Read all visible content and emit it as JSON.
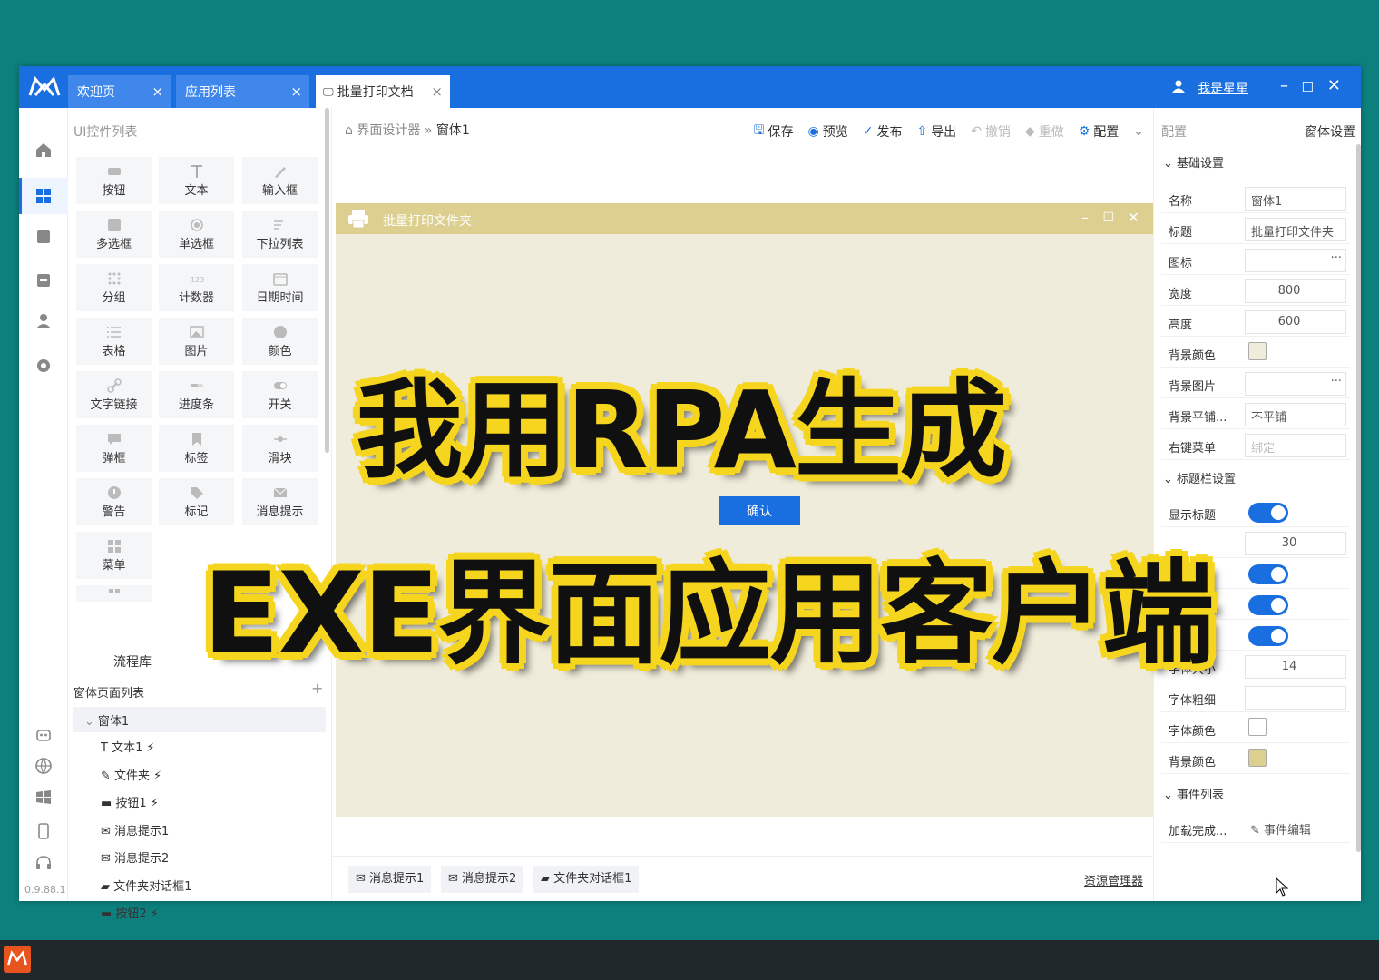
{
  "tabs": [
    {
      "label": "欢迎页",
      "close": "×"
    },
    {
      "label": "应用列表",
      "close": "×"
    },
    {
      "label": "批量打印文档",
      "close": "×"
    }
  ],
  "user": {
    "name": "我是星星"
  },
  "window_buttons": {
    "min": "–",
    "max": "☐",
    "close": "✕"
  },
  "version": "0.9.88.1",
  "palette": {
    "title": "UI控件列表",
    "controls": [
      "按钮",
      "文本",
      "输入框",
      "多选框",
      "单选框",
      "下拉列表",
      "分组",
      "计数器",
      "日期时间",
      "表格",
      "图片",
      "颜色",
      "文字链接",
      "进度条",
      "开关",
      "弹框",
      "标签",
      "滑块",
      "警告",
      "标记",
      "消息提示",
      "菜单"
    ],
    "flow_tab": "流程库",
    "window_list_title": "窗体页面列表",
    "tree_root": "窗体1",
    "tree_items": [
      {
        "label": "文本1",
        "bolt": "⚡"
      },
      {
        "label": "文件夹",
        "bolt": "⚡"
      },
      {
        "label": "按钮1",
        "bolt": "⚡"
      },
      {
        "label": "消息提示1",
        "bolt": ""
      },
      {
        "label": "消息提示2",
        "bolt": ""
      },
      {
        "label": "文件夹对话框1",
        "bolt": ""
      },
      {
        "label": "按钮2",
        "bolt": "⚡"
      }
    ]
  },
  "breadcrumb": {
    "root": "界面设计器",
    "sep": "»",
    "current": "窗体1"
  },
  "toolbar": {
    "save": "保存",
    "preview": "预览",
    "publish": "发布",
    "export": "导出",
    "undo": "撤销",
    "redo": "重做",
    "config": "配置"
  },
  "canvas": {
    "title": "批量打印文件夹",
    "confirm": "确认"
  },
  "bottom_chips": [
    "消息提示1",
    "消息提示2",
    "文件夹对话框1"
  ],
  "resource_link": "资源管理器",
  "right_panel": {
    "head": "配置",
    "head_right": "窗体设置",
    "sec_basic": "基础设置",
    "name_label": "名称",
    "name_value": "窗体1",
    "title_label": "标题",
    "title_value": "批量打印文件夹",
    "icon_label": "图标",
    "dots": "···",
    "width_label": "宽度",
    "width_value": "800",
    "height_label": "高度",
    "height_value": "600",
    "bg_color_label": "背景颜色",
    "bg_image_label": "背景图片",
    "bg_tile_label": "背景平铺...",
    "bg_tile_value": "不平铺",
    "ctx_menu_label": "右键菜单",
    "ctx_menu_value": "绑定",
    "sec_titlebar": "标题栏设置",
    "show_title_label": "显示标题",
    "title_height_value": "30",
    "font_size_label": "字体大小",
    "font_size_value": "14",
    "font_weight_label": "字体粗细",
    "font_color_label": "字体颜色",
    "tb_bg_color_label": "背景颜色",
    "sec_events": "事件列表",
    "event_label": "加载完成...",
    "event_value": "事件编辑"
  },
  "overlay": {
    "line1": "我用RPA生成",
    "line2": "EXE界面应用客户端"
  },
  "colors": {
    "accent": "#1a6fe0",
    "desktop": "#0d7f7d",
    "canvas_title": "#dccf90",
    "canvas_bg": "#f0ecdb",
    "overlay_stroke": "#f5d51e"
  }
}
